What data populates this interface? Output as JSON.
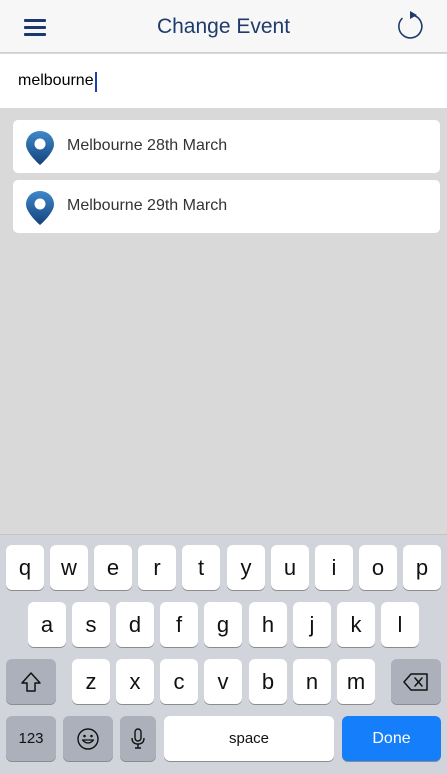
{
  "header": {
    "title": "Change Event",
    "accent_color": "#1f3b6b"
  },
  "search": {
    "value": "melbourne",
    "placeholder": ""
  },
  "results": [
    {
      "label": "Melbourne 28th March",
      "icon": "location-pin-icon"
    },
    {
      "label": "Melbourne 29th March",
      "icon": "location-pin-icon"
    }
  ],
  "keyboard": {
    "row1": [
      "q",
      "w",
      "e",
      "r",
      "t",
      "y",
      "u",
      "i",
      "o",
      "p"
    ],
    "row2": [
      "a",
      "s",
      "d",
      "f",
      "g",
      "h",
      "j",
      "k",
      "l"
    ],
    "row3": [
      "z",
      "x",
      "c",
      "v",
      "b",
      "n",
      "m"
    ],
    "numbers_label": "123",
    "space_label": "space",
    "done_label": "Done",
    "done_color": "#147efb"
  }
}
